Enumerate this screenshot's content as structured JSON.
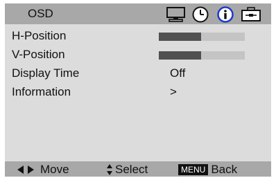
{
  "header": {
    "title": "OSD",
    "icons": [
      "monitor-icon",
      "clock-icon",
      "info-icon",
      "toolbox-icon"
    ],
    "selected_icon": "info-icon"
  },
  "menu": {
    "items": [
      {
        "label": "H-Position",
        "level": 0.49
      },
      {
        "label": "V-Position",
        "level": 0.49
      },
      {
        "label": "Display Time",
        "value": "Off"
      },
      {
        "label": "Information",
        "value": ">"
      }
    ]
  },
  "footer": {
    "move_label": "Move",
    "select_label": "Select",
    "menu_key": "MENU",
    "back_label": "Back"
  },
  "colors": {
    "header_bg": "#a8a8a8",
    "body_bg": "#dcdcdc",
    "bar_fill": "#505050",
    "bar_track": "#c4c4c4",
    "info_icon_blue": "#1a3ad0"
  }
}
